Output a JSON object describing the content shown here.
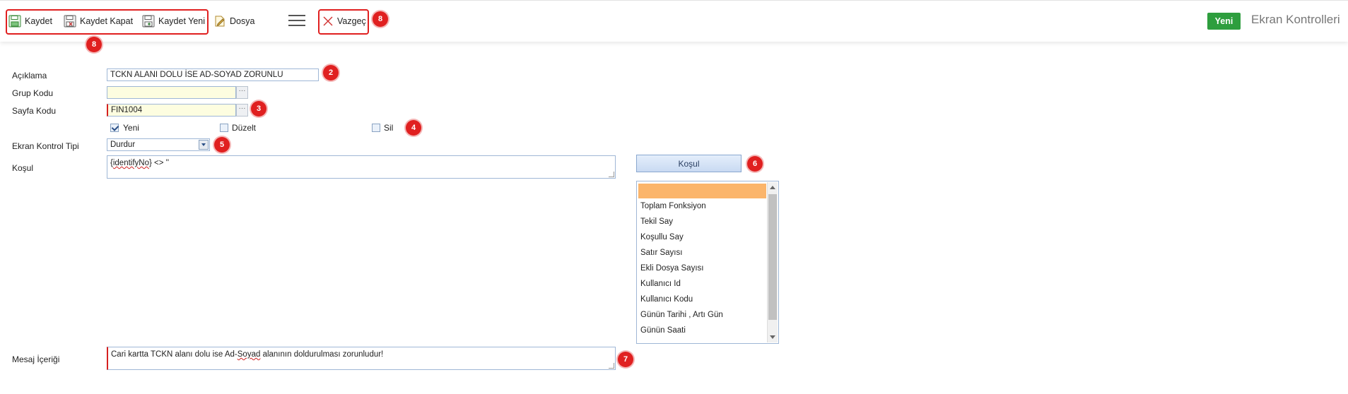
{
  "toolbar": {
    "save_label": "Kaydet",
    "save_close_label": "Kaydet Kapat",
    "save_new_label": "Kaydet Yeni",
    "file_label": "Dosya",
    "cancel_label": "Vazgeç",
    "new_label": "Yeni",
    "screen_title": "Ekran Kontrolleri",
    "group_badge": "8",
    "cancel_badge": "8"
  },
  "form": {
    "description": {
      "label": "Açıklama",
      "value": "TCKN ALANI DOLU İSE AD-SOYAD ZORUNLU",
      "badge": "2"
    },
    "group_code": {
      "label": "Grup Kodu",
      "value": ""
    },
    "page_code": {
      "label": "Sayfa Kodu",
      "value": "FIN1004",
      "badge": "3"
    },
    "permissions": {
      "badge": "4",
      "new": {
        "label": "Yeni",
        "checked": true
      },
      "edit": {
        "label": "Düzelt",
        "checked": false
      },
      "delete": {
        "label": "Sil",
        "checked": false
      }
    },
    "control_type": {
      "label": "Ekran Kontrol Tipi",
      "value": "Durdur",
      "badge": "5"
    },
    "condition": {
      "label": "Koşul",
      "value_prefix": "{",
      "value_word": "identifyNo",
      "value_suffix": "} <> ''"
    },
    "message": {
      "label": "Mesaj İçeriği",
      "value_before": "Cari kartta TCKN alanı dolu ise Ad-",
      "value_word": "Soyad",
      "value_after": " alanının doldurulması zorunludur!",
      "badge": "7"
    }
  },
  "condition_panel": {
    "button_label": "Koşul",
    "badge": "6",
    "selected_item": "",
    "items": [
      "Toplam Fonksiyon",
      "Tekil Say",
      "Koşullu Say",
      "Satır Sayısı",
      "Ekli Dosya Sayısı",
      "Kullanıcı Id",
      "Kullanıcı Kodu",
      "Günün Tarihi , Artı Gün",
      "Günün Saati"
    ]
  },
  "colors": {
    "annotation_red": "#e02020",
    "new_button_green": "#2e9e3e",
    "selected_item": "#fbb56b"
  }
}
